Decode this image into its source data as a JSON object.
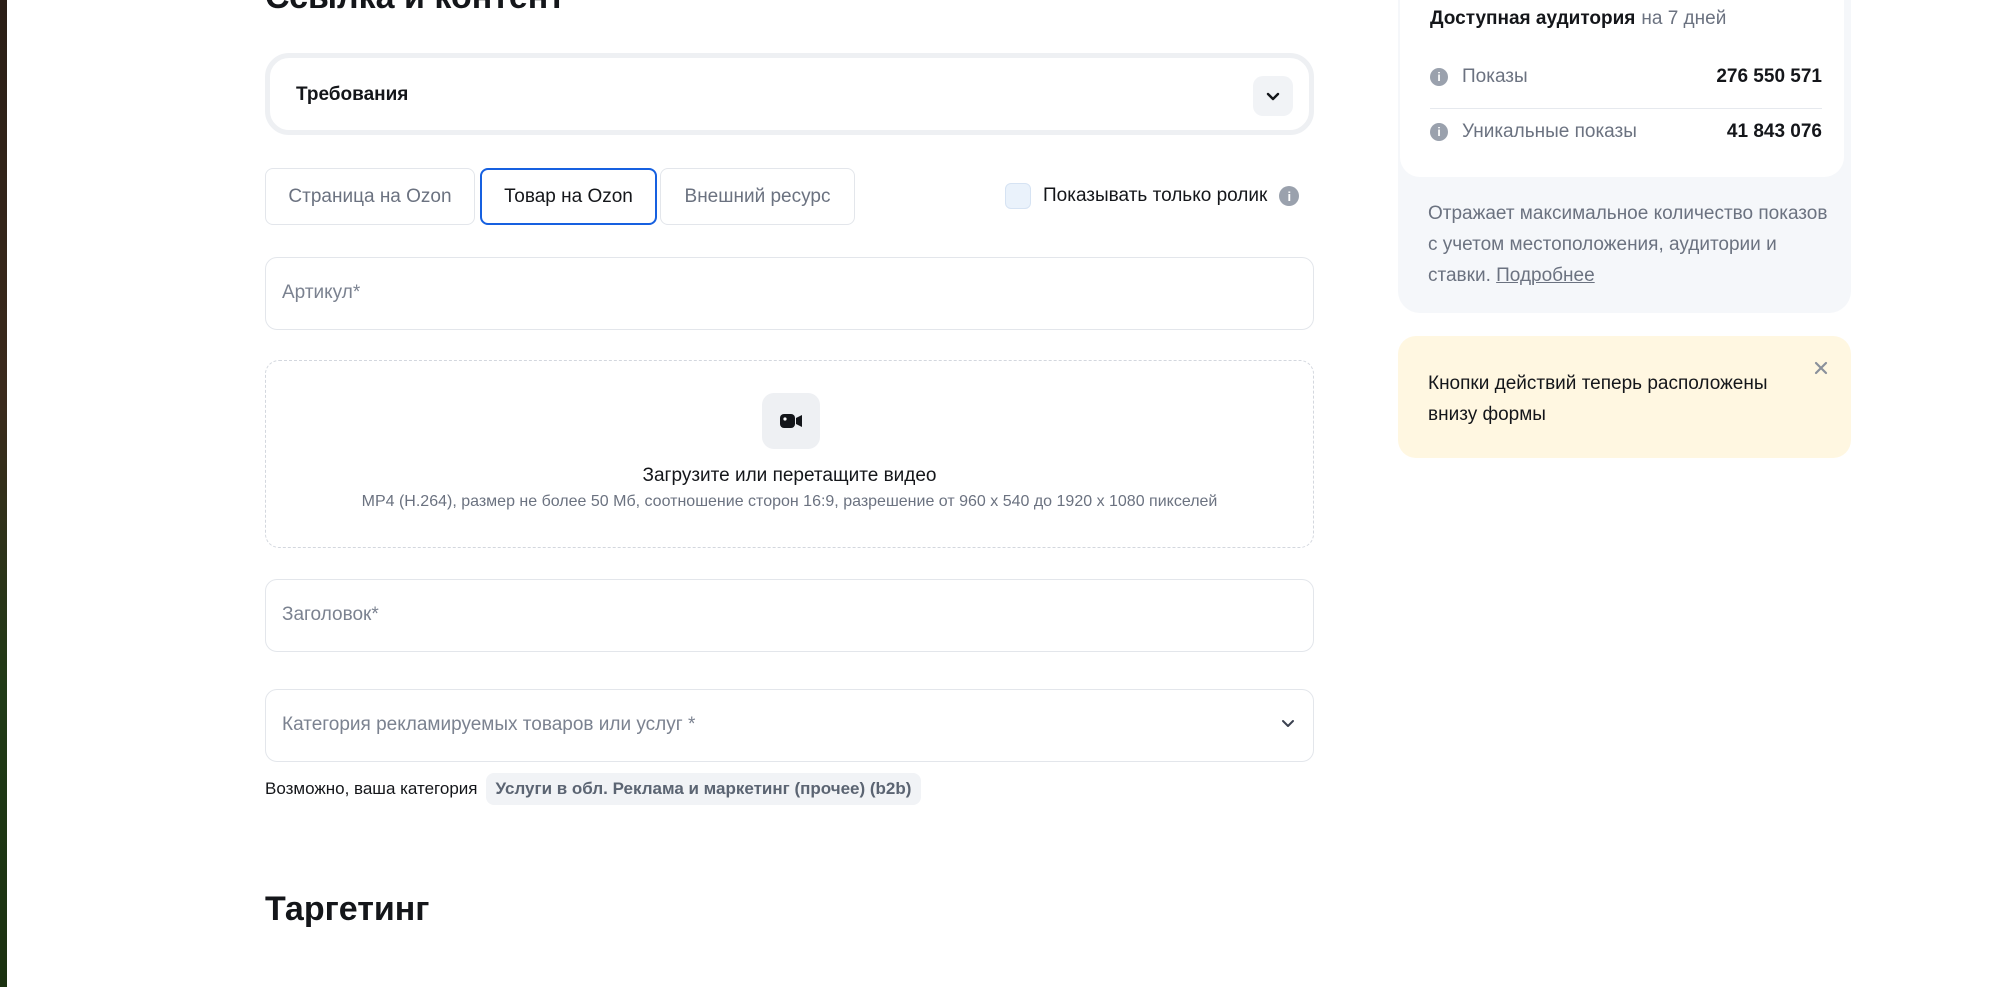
{
  "section_title": "Ссылка и контент",
  "requirements": {
    "label": "Требования",
    "icon": "chevron-down-icon"
  },
  "destination_tabs": [
    {
      "label": "Страница на Ozon",
      "selected": false
    },
    {
      "label": "Товар на Ozon",
      "selected": true
    },
    {
      "label": "Внешний ресурс",
      "selected": false
    }
  ],
  "show_only_video": {
    "label": "Показывать только ролик",
    "checked": false,
    "icon": "info-icon"
  },
  "fields": {
    "sku_placeholder": "Артикул*",
    "headline_placeholder": "Заголовок*",
    "category_placeholder": "Категория рекламируемых товаров или услуг *"
  },
  "upload": {
    "icon": "video-camera-icon",
    "title": "Загрузите или перетащите видео",
    "hint": "MP4 (H.264), размер не более 50 Мб, соотношение сторон 16:9, разрешение от 960 x 540 до 1920 x 1080 пикселей"
  },
  "category_suggestion": {
    "text": "Возможно, ваша категория",
    "chip": "Услуги в обл. Реклама и маркетинг (прочее) (b2b)"
  },
  "targeting_title": "Таргетинг",
  "audience": {
    "title": "Доступная аудитория",
    "period": "на 7 дней",
    "rows": [
      {
        "label": "Показы",
        "value": "276 550 571"
      },
      {
        "label": "Уникальные показы",
        "value": "41 843 076"
      }
    ],
    "description": "Отражает максимальное количество показов с учетом местоположения, аудитории и ставки.",
    "more_link": "Подробнее"
  },
  "notice": {
    "text": "Кнопки действий теперь расположены внизу формы",
    "close_icon": "close-icon"
  },
  "colors": {
    "accent": "#1660e0",
    "notice_bg": "#fff7e1",
    "panel_bg": "#f5f7fa"
  }
}
